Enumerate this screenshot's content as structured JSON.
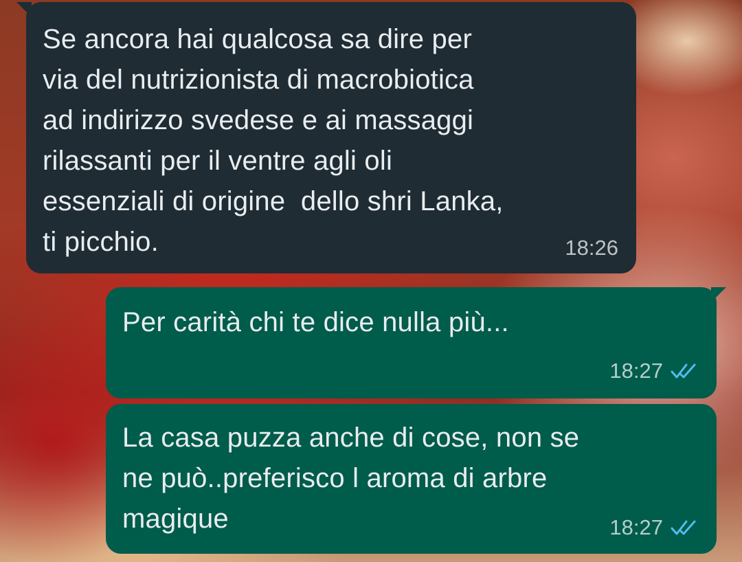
{
  "chat": {
    "messages": [
      {
        "direction": "incoming",
        "text": "Se ancora hai qualcosa sa dire per\nvia del nutrizionista di macrobiotica\nad indirizzo svedese e ai massaggi\nrilassanti per il ventre agli oli\nessenziali di origine  dello shri Lanka,\nti picchio.",
        "time": "18:26"
      },
      {
        "direction": "outgoing",
        "text": "Per carità chi te dice nulla più...",
        "time": "18:27",
        "status": "read",
        "status_icon": "double-check-icon"
      },
      {
        "direction": "outgoing",
        "text": "La casa puzza anche di cose, non se\nne può..preferisco l aroma di arbre\nmagique",
        "time": "18:27",
        "status": "read",
        "status_icon": "double-check-icon"
      }
    ]
  },
  "colors": {
    "incoming_bubble": "#1f2c34",
    "outgoing_bubble": "#005c4b",
    "read_ticks": "#53bdeb",
    "text": "#e9edef"
  }
}
